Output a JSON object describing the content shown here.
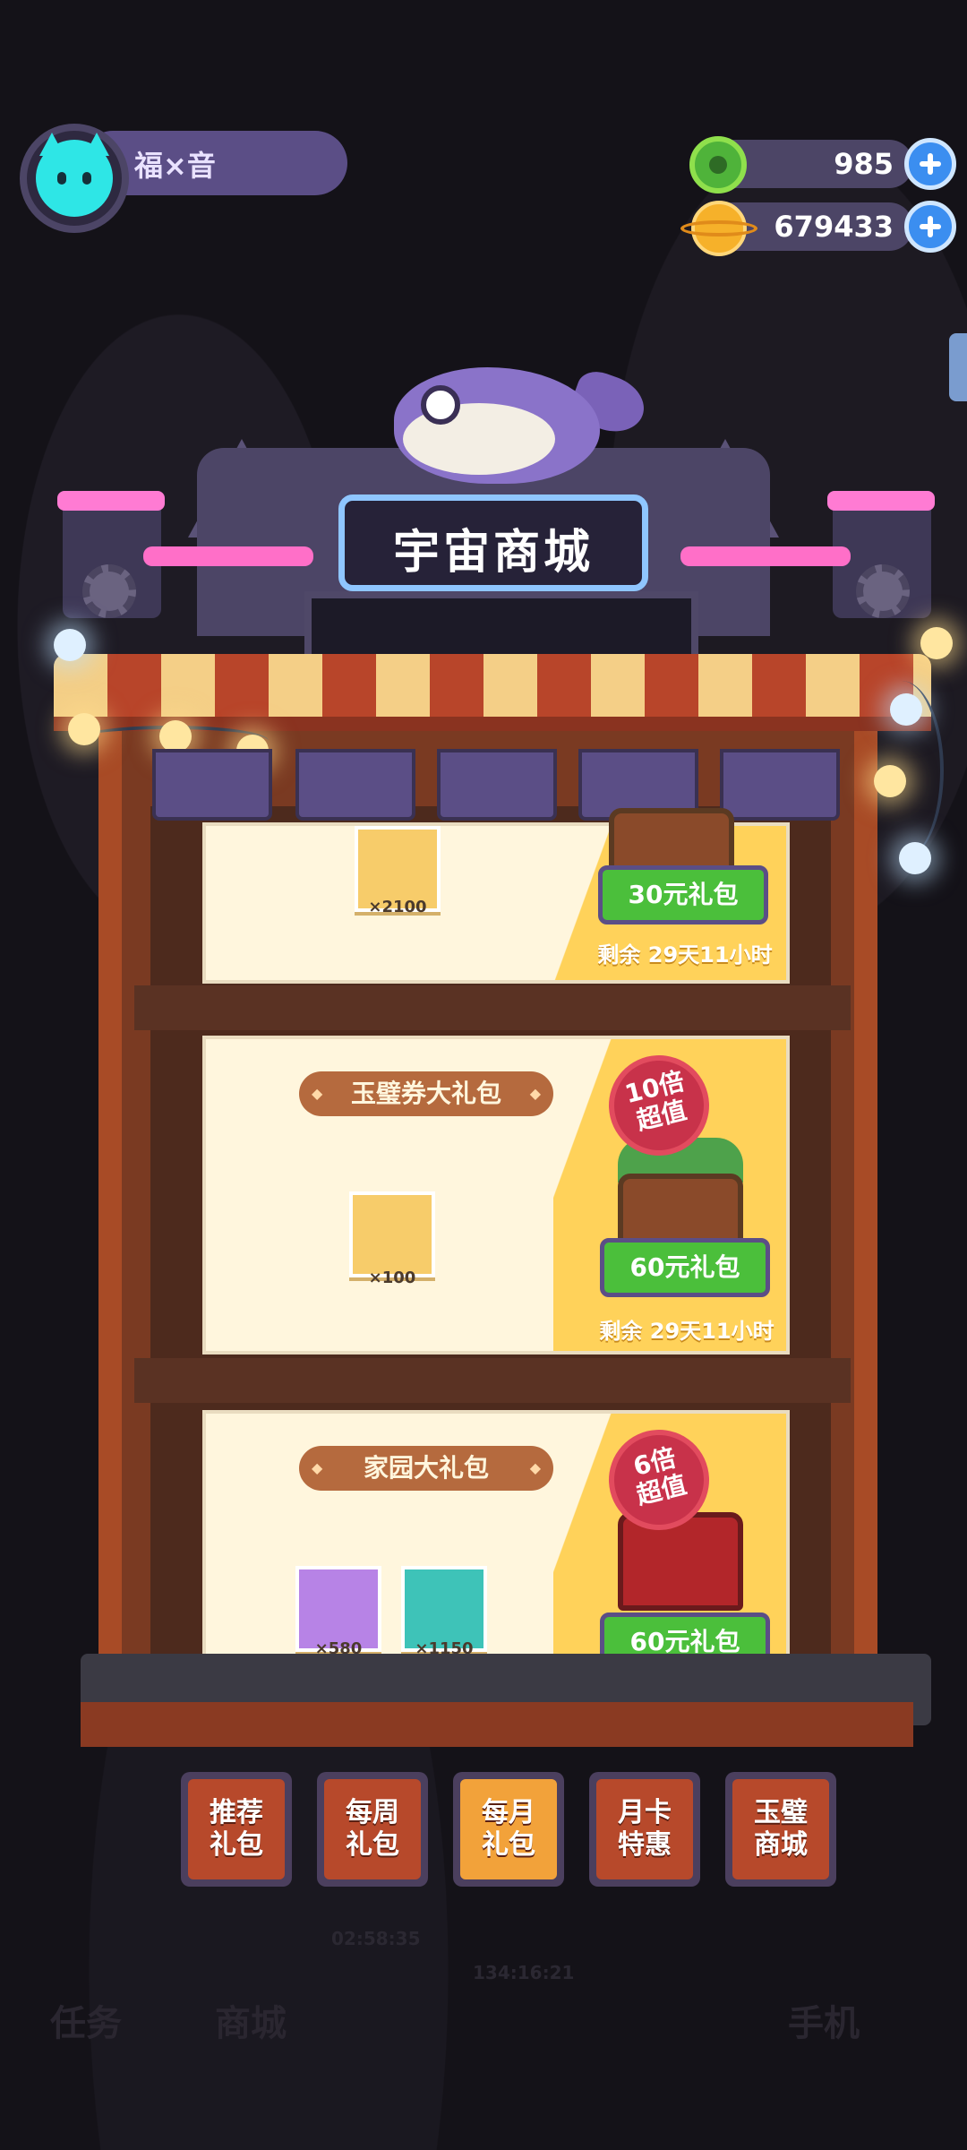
{
  "user": {
    "name": "福×音"
  },
  "currency": {
    "jade": "985",
    "coins": "679433"
  },
  "shop": {
    "title": "宇宙商城"
  },
  "packs": [
    {
      "title": "",
      "items": [
        {
          "count": "×2100",
          "icon": "jade-coin-icon"
        }
      ],
      "price": "30元礼包",
      "remaining": "剩余 29天11小时",
      "badge": ""
    },
    {
      "title": "玉璧券大礼包",
      "items": [
        {
          "count": "×100",
          "icon": "jade-ticket-icon"
        }
      ],
      "price": "60元礼包",
      "remaining": "剩余 29天11小时",
      "badge": "10倍\n超值"
    },
    {
      "title": "家园大礼包",
      "items": [
        {
          "count": "×580",
          "icon": "refresh-card-icon"
        },
        {
          "count": "×1150",
          "icon": "upgrade-card-icon"
        }
      ],
      "price": "60元礼包",
      "remaining": "",
      "badge": "6倍\n超值"
    }
  ],
  "tabs": [
    {
      "label": "推荐\n礼包",
      "active": false
    },
    {
      "label": "每周\n礼包",
      "active": false
    },
    {
      "label": "每月\n礼包",
      "active": true
    },
    {
      "label": "月卡\n特惠",
      "active": false
    },
    {
      "label": "玉璧\n商城",
      "active": false
    }
  ],
  "background": {
    "times": [
      "02:58:35",
      "134:16:21"
    ],
    "nav": [
      "任务",
      "商城",
      "手机"
    ]
  },
  "colors": {
    "accent_green": "#4bbf3b",
    "awning_red": "#b8452a",
    "frame_purple": "#5b4e86"
  }
}
